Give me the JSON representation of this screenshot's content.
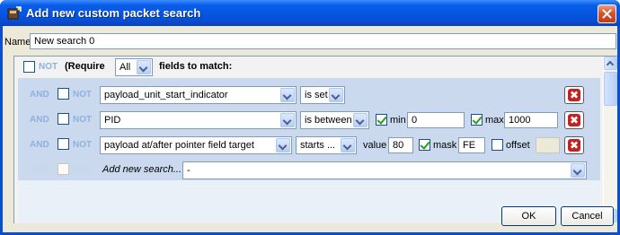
{
  "window": {
    "title": "Add new custom packet search"
  },
  "name_field": {
    "label": "Name",
    "value": "New search 0"
  },
  "group": {
    "not_label": "NOT",
    "require_label": "(Require",
    "require_value": "All",
    "fields_label": "fields to match:"
  },
  "conditions": [
    {
      "logic": "AND",
      "not": "NOT",
      "field": "payload_unit_start_indicator",
      "op": "is set"
    },
    {
      "logic": "AND",
      "not": "NOT",
      "field": "PID",
      "op": "is between",
      "min_label": "min",
      "min_value": "0",
      "max_label": "max",
      "max_value": "1000"
    },
    {
      "logic": "AND",
      "not": "NOT",
      "field": "payload at/after pointer field target",
      "op": "starts ...",
      "value_label": "value",
      "value_value": "80",
      "mask_label": "mask",
      "mask_value": "FE",
      "offset_label": "offset",
      "offset_value": ""
    }
  ],
  "add_row": {
    "logic": "AND",
    "not": "NOT",
    "label": "Add new search...",
    "value": "-"
  },
  "buttons": {
    "ok": "OK",
    "cancel": "Cancel"
  },
  "icons": {
    "delete": "delete-icon",
    "close": "close-icon"
  },
  "colors": {
    "title_blue": "#0455e0",
    "condition_bg": "#cad9ee",
    "delete_red": "#c32222"
  }
}
